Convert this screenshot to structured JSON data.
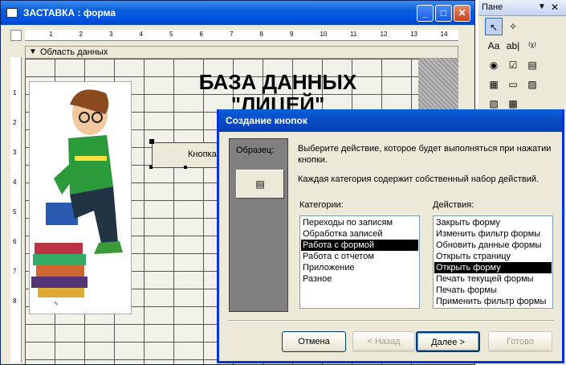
{
  "form_window": {
    "title": "ЗАСТАВКА : форма",
    "section_label": "Область данных",
    "ruler_ticks": [
      "1",
      "2",
      "3",
      "4",
      "5",
      "6",
      "7",
      "8",
      "9",
      "10",
      "11",
      "12",
      "13",
      "14"
    ],
    "vruler_ticks": [
      "1",
      "2",
      "3",
      "4",
      "5",
      "6",
      "7",
      "8"
    ],
    "heading_line1": "БАЗА ДАННЫХ",
    "heading_line2": "\"ЛИЦЕЙ\"",
    "button_caption": "Кнопка"
  },
  "toolbox": {
    "title": "Пане",
    "tools": [
      "pointer-icon",
      "wizard-icon",
      "label-icon",
      "textbox-icon",
      "option-group-icon",
      "option-button-icon",
      "checkbox-icon",
      "combo-box-icon",
      "list-box-icon",
      "command-button-icon",
      "image-icon",
      "unbound-frame-icon",
      "bound-frame-icon"
    ],
    "tool_glyphs": [
      "↖",
      "✧",
      "Aa",
      "ab|",
      "⁽ᵡ⁾",
      "◉",
      "☑",
      "▤",
      "▦",
      "▭",
      "▨",
      "▧",
      "▩"
    ]
  },
  "dialog": {
    "title": "Создание кнопок",
    "sample_label": "Образец:",
    "instruction1": "Выберите действие, которое будет выполняться при нажатии кнопки.",
    "instruction2": "Каждая категория содержит собственный набор действий.",
    "categories_label": "Категории:",
    "actions_label": "Действия:",
    "categories": [
      "Переходы по записям",
      "Обработка записей",
      "Работа с формой",
      "Работа с отчетом",
      "Приложение",
      "Разное"
    ],
    "selected_category": "Работа с формой",
    "actions": [
      "Закрыть форму",
      "Изменить фильтр формы",
      "Обновить данные формы",
      "Открыть страницу",
      "Открыть форму",
      "Печать текущей формы",
      "Печать формы",
      "Применить фильтр формы"
    ],
    "selected_action": "Открыть форму",
    "buttons": {
      "cancel": "Отмена",
      "back": "< Назад",
      "next": "Далее >",
      "finish": "Готово"
    }
  },
  "colors": {
    "titlebar": "#0054e3",
    "selection": "#000000",
    "dialog_bg": "#ece9d8"
  }
}
